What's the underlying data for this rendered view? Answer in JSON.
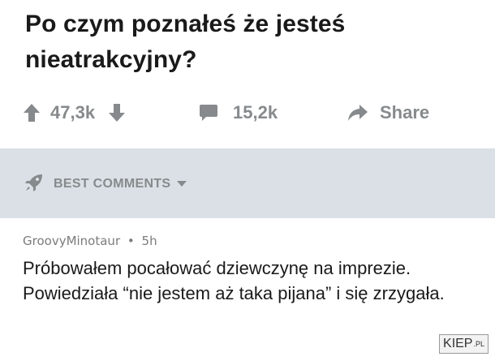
{
  "post": {
    "title": "Po czym poznałeś że jesteś nieatrakcyjny?"
  },
  "actions": {
    "upvote_icon": "arrow-up-icon",
    "vote_count": "47,3k",
    "downvote_icon": "arrow-down-icon",
    "comments_icon": "comment-bubble-icon",
    "comment_count": "15,2k",
    "share_icon": "share-arrow-icon",
    "share_label": "Share"
  },
  "sort": {
    "icon": "rocket-icon",
    "label": "BEST COMMENTS",
    "caret_icon": "caret-down-icon"
  },
  "comment": {
    "author": "GroovyMinotaur",
    "separator": "•",
    "age": "5h",
    "body": "Próbowałem pocałować dziewczynę na imprezie. Powiedziała “nie jestem aż taka pijana” i się zrzygała."
  },
  "watermark": {
    "main": "KIEP",
    "suffix": ".PL"
  },
  "colors": {
    "text": "#1a1a1b",
    "muted": "#878a8c",
    "band": "#dae0e6",
    "background": "#ffffff"
  }
}
